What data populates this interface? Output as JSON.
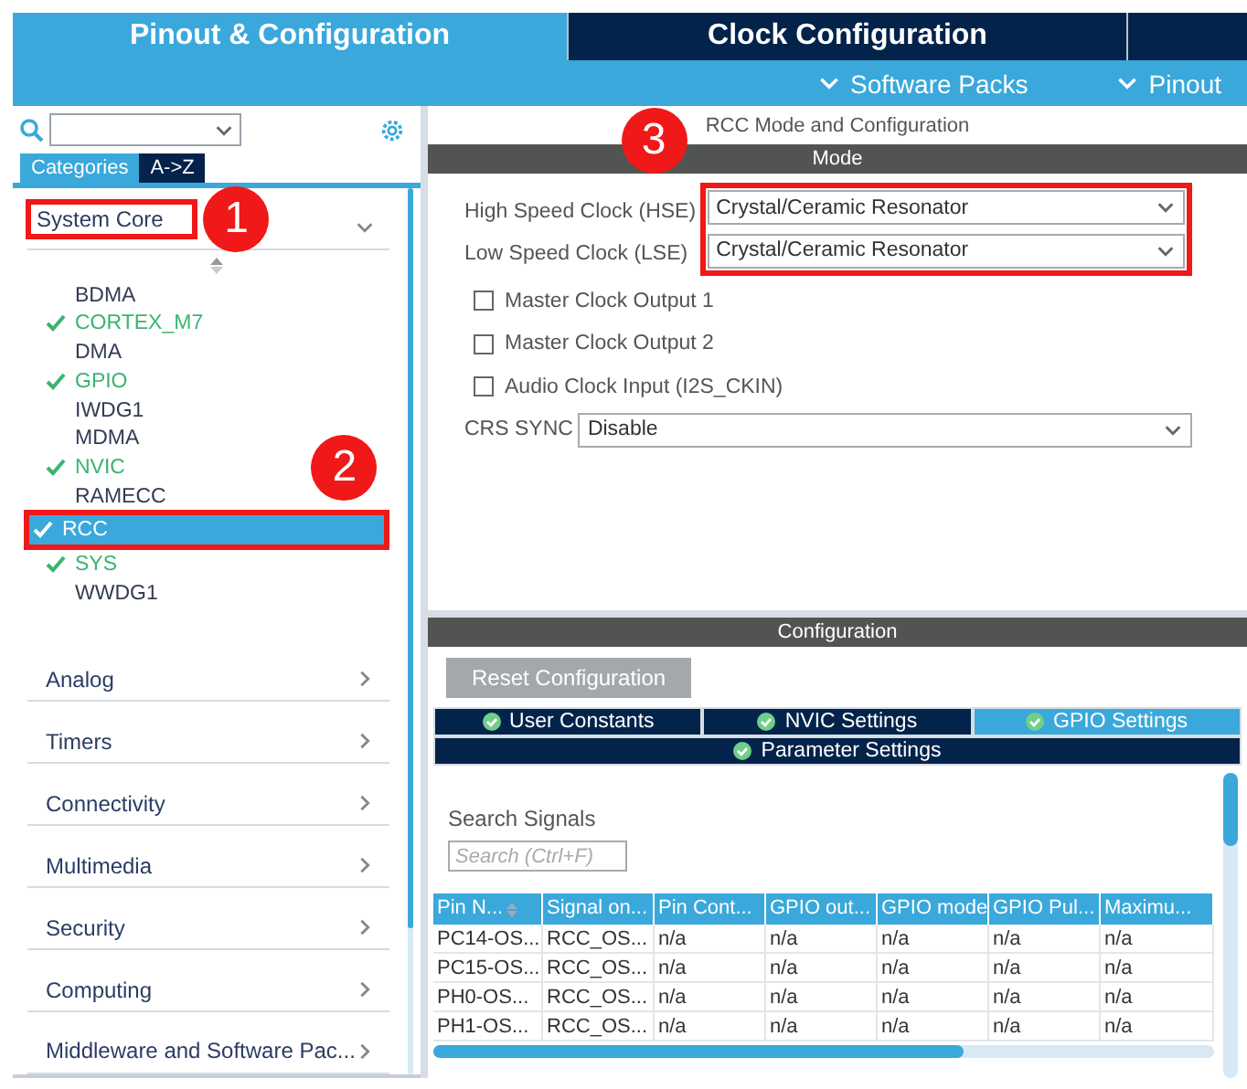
{
  "top_tabs": [
    {
      "label": "Pinout & Configuration",
      "selected": true
    },
    {
      "label": "Clock Configuration",
      "selected": false
    }
  ],
  "sub_menu": [
    "Software Packs",
    "Pinout"
  ],
  "sidebar": {
    "view_tabs": [
      {
        "label": "Categories",
        "selected": true
      },
      {
        "label": "A->Z",
        "selected": false
      }
    ],
    "sections": [
      {
        "label": "System Core",
        "expanded": true,
        "callout": "1",
        "items": [
          {
            "label": "BDMA",
            "checked": false,
            "selected": false
          },
          {
            "label": "CORTEX_M7",
            "checked": true,
            "selected": false
          },
          {
            "label": "DMA",
            "checked": false,
            "selected": false
          },
          {
            "label": "GPIO",
            "checked": true,
            "selected": false
          },
          {
            "label": "IWDG1",
            "checked": false,
            "selected": false
          },
          {
            "label": "MDMA",
            "checked": false,
            "selected": false
          },
          {
            "label": "NVIC",
            "checked": true,
            "selected": false
          },
          {
            "label": "RAMECC",
            "checked": false,
            "selected": false
          },
          {
            "label": "RCC",
            "checked": true,
            "selected": true,
            "callout": "2"
          },
          {
            "label": "SYS",
            "checked": true,
            "selected": false
          },
          {
            "label": "WWDG1",
            "checked": false,
            "selected": false
          }
        ]
      },
      {
        "label": "Analog",
        "expanded": false
      },
      {
        "label": "Timers",
        "expanded": false
      },
      {
        "label": "Connectivity",
        "expanded": false
      },
      {
        "label": "Multimedia",
        "expanded": false
      },
      {
        "label": "Security",
        "expanded": false
      },
      {
        "label": "Computing",
        "expanded": false
      },
      {
        "label": "Middleware and Software Pac...",
        "expanded": false
      }
    ]
  },
  "mode_panel": {
    "title": "RCC Mode and Configuration",
    "header": "Mode",
    "fields": [
      {
        "kind": "select",
        "label": "High Speed Clock (HSE)",
        "value": "Crystal/Ceramic Resonator",
        "framed": true,
        "callout": "3"
      },
      {
        "kind": "select",
        "label": "Low Speed Clock (LSE)",
        "value": "Crystal/Ceramic Resonator",
        "framed": true
      },
      {
        "kind": "checkbox",
        "label": "Master Clock Output 1",
        "checked": false
      },
      {
        "kind": "checkbox",
        "label": "Master Clock Output 2",
        "checked": false
      },
      {
        "kind": "checkbox",
        "label": "Audio Clock Input (I2S_CKIN)",
        "checked": false
      },
      {
        "kind": "select",
        "label": "CRS SYNC",
        "value": "Disable"
      }
    ]
  },
  "config_panel": {
    "header": "Configuration",
    "reset_button": "Reset Configuration",
    "tabs": [
      {
        "label": "User Constants",
        "selected": false
      },
      {
        "label": "NVIC Settings",
        "selected": false
      },
      {
        "label": "GPIO Settings",
        "selected": true
      },
      {
        "label": "Parameter Settings",
        "selected": false
      }
    ],
    "search_label": "Search Signals",
    "search": {
      "placeholder": "Search (Ctrl+F)"
    },
    "table": {
      "columns": [
        "Pin N...",
        "Signal on...",
        "Pin Cont...",
        "GPIO out...",
        "GPIO mode",
        "GPIO Pul...",
        "Maximu..."
      ],
      "rows": [
        [
          "PC14-OS...",
          "RCC_OS...",
          "n/a",
          "n/a",
          "n/a",
          "n/a",
          "n/a"
        ],
        [
          "PC15-OS...",
          "RCC_OS...",
          "n/a",
          "n/a",
          "n/a",
          "n/a",
          "n/a"
        ],
        [
          "PH0-OS...",
          "RCC_OS...",
          "n/a",
          "n/a",
          "n/a",
          "n/a",
          "n/a"
        ],
        [
          "PH1-OS...",
          "RCC_OS...",
          "n/a",
          "n/a",
          "n/a",
          "n/a",
          "n/a"
        ]
      ]
    }
  }
}
